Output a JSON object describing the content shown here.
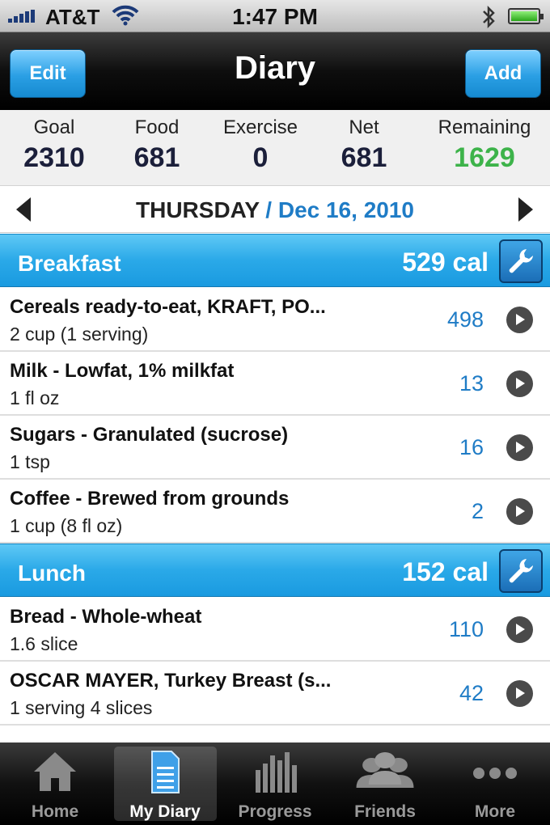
{
  "status_bar": {
    "carrier": "AT&T",
    "time": "1:47 PM"
  },
  "nav": {
    "edit_label": "Edit",
    "title": "Diary",
    "add_label": "Add"
  },
  "summary": [
    {
      "label": "Goal",
      "value": "2310"
    },
    {
      "label": "Food",
      "value": "681"
    },
    {
      "label": "Exercise",
      "value": "0"
    },
    {
      "label": "Net",
      "value": "681"
    },
    {
      "label": "Remaining",
      "value": "1629"
    }
  ],
  "date_nav": {
    "day": "THURSDAY",
    "separator": " / ",
    "date": "Dec 16, 2010"
  },
  "meals": [
    {
      "name": "Breakfast",
      "calories": "529 cal",
      "items": [
        {
          "name": "Cereals ready-to-eat, KRAFT, PO...",
          "serving": "2 cup (1 serving)",
          "calories": "498"
        },
        {
          "name": "Milk - Lowfat, 1% milkfat",
          "serving": "1 fl oz",
          "calories": "13"
        },
        {
          "name": "Sugars - Granulated (sucrose)",
          "serving": "1 tsp",
          "calories": "16"
        },
        {
          "name": "Coffee - Brewed from grounds",
          "serving": "1 cup (8 fl oz)",
          "calories": "2"
        }
      ]
    },
    {
      "name": "Lunch",
      "calories": "152 cal",
      "items": [
        {
          "name": "Bread - Whole-wheat",
          "serving": "1.6 slice",
          "calories": "110"
        },
        {
          "name": "OSCAR MAYER, Turkey Breast (s...",
          "serving": "1 serving 4 slices",
          "calories": "42"
        }
      ]
    }
  ],
  "tabs": [
    {
      "label": "Home",
      "icon": "home-icon"
    },
    {
      "label": "My Diary",
      "icon": "diary-icon",
      "active": true
    },
    {
      "label": "Progress",
      "icon": "bar-chart-icon"
    },
    {
      "label": "Friends",
      "icon": "friends-icon"
    },
    {
      "label": "More",
      "icon": "more-icon"
    }
  ],
  "colors": {
    "accent": "#2aa9e8",
    "remaining": "#3db34a",
    "link": "#1f7cc6"
  }
}
